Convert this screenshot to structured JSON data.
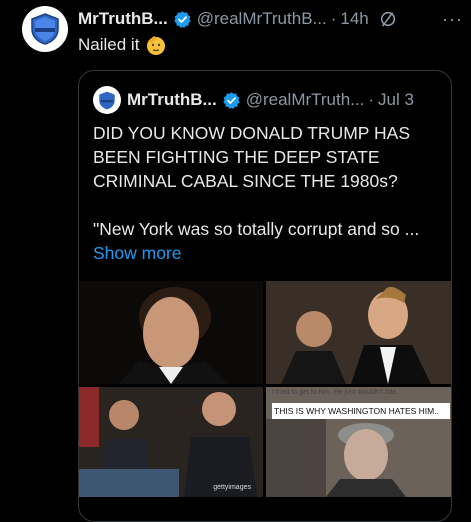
{
  "tweet": {
    "author_name": "MrTruthB...",
    "handle": "@realMrTruthB...",
    "separator": "·",
    "time": "14h",
    "more": "···",
    "text": "Nailed it",
    "emoji": "saluting-face"
  },
  "quoted": {
    "author_name": "MrTruthB...",
    "handle": "@realMrTruth...",
    "separator": "·",
    "time": "Jul 3",
    "lines": [
      "DID YOU KNOW DONALD TRUMP HAS",
      "BEEN FIGHTING THE DEEP STATE",
      "CRIMINAL CABAL SINCE THE 1980s?"
    ],
    "quote_line": "\"New York was so totally corrupt and so ...",
    "show_more": "Show more",
    "media": {
      "image4_faded_text": "I tried to get to him. He just wouldn't bite.",
      "image4_caption": "THIS IS WHY WASHINGTON HATES HIM..",
      "image3_watermark": "gettyimages"
    }
  },
  "colors": {
    "background": "#000000",
    "text": "#e7e9ea",
    "muted": "#8b98a5",
    "link": "#1d9bf0",
    "verified": "#1d9bf0"
  }
}
